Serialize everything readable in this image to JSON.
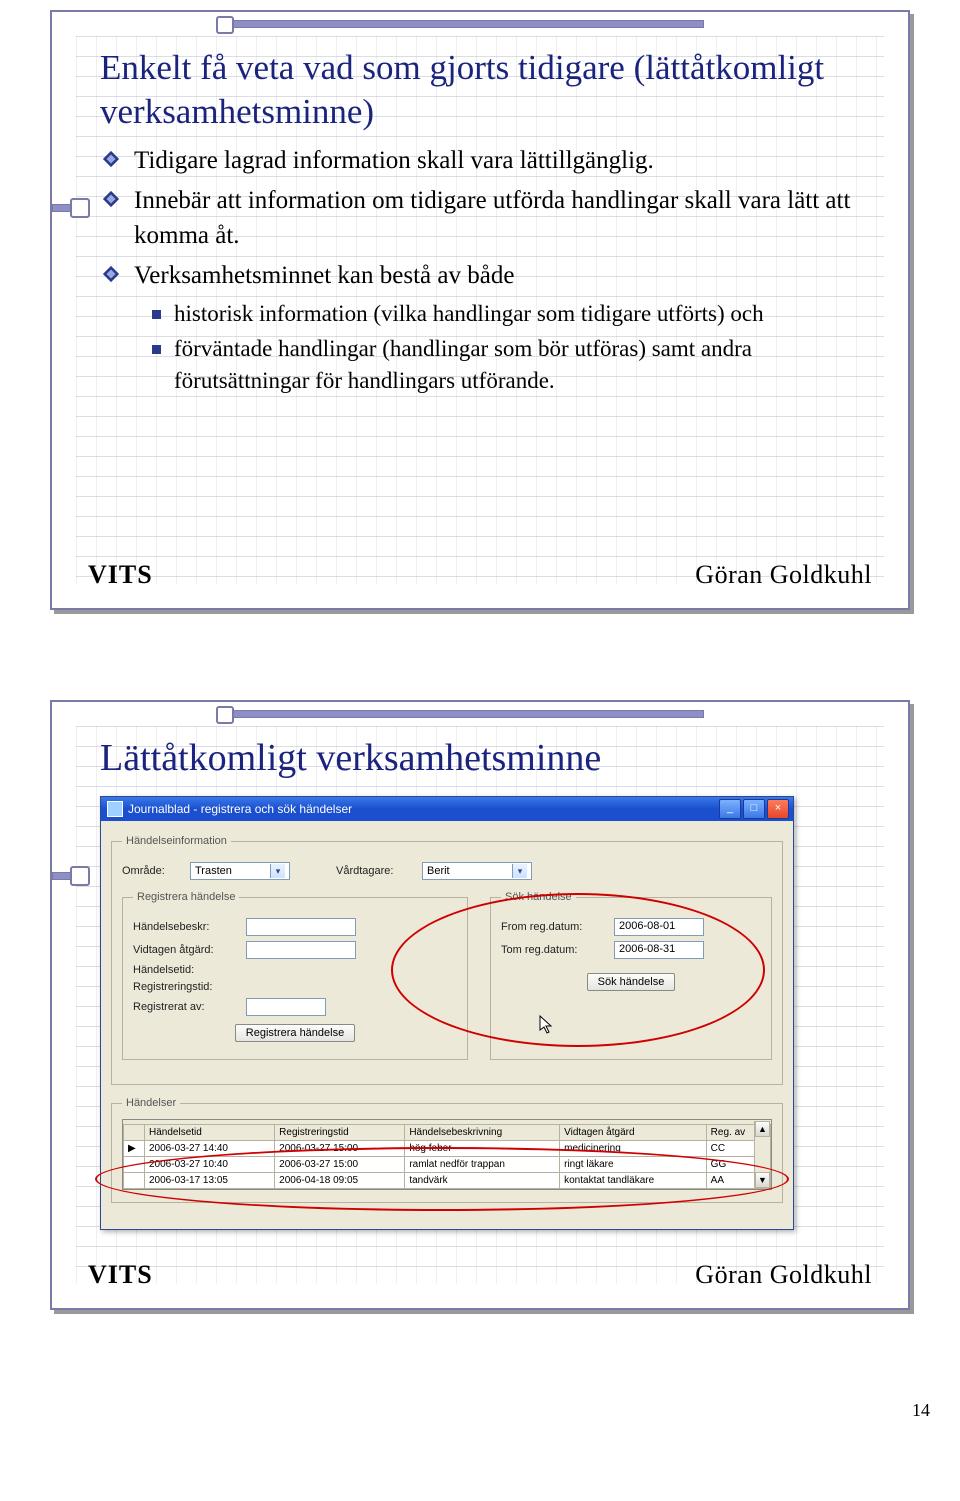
{
  "page_number": "14",
  "slide1": {
    "title": "Enkelt få veta vad som gjorts tidigare (lättåtkomligt verksamhetsminne)",
    "bullets": [
      "Tidigare lagrad information skall vara lättillgänglig.",
      "Innebär att information om tidigare utförda handlingar skall vara lätt att komma åt.",
      "Verksamhetsminnet kan bestå av både"
    ],
    "sub_bullets": [
      "historisk information (vilka handlingar som tidigare utförts) och",
      "förväntade handlingar (handlingar som bör utföras) samt andra förutsättningar för handlingars utförande."
    ],
    "footer_left": "VITS",
    "footer_right": "Göran Goldkuhl"
  },
  "slide2": {
    "title": "Lättåtkomligt verksamhetsminne",
    "footer_left": "VITS",
    "footer_right": "Göran Goldkuhl",
    "app": {
      "window_title": "Journalblad - registrera och sök händelser",
      "win_min": "_",
      "win_max": "□",
      "win_close": "×",
      "info_legend": "Händelseinformation",
      "omrade_label": "Område:",
      "omrade_value": "Trasten",
      "vardtagare_label": "Vårdtagare:",
      "vardtagare_value": "Berit",
      "reg_legend": "Registrera händelse",
      "fields": {
        "handelsebeskr": "Händelsebeskr:",
        "vidtagen": "Vidtagen åtgärd:",
        "handelsetid": "Händelsetid:",
        "registreringstid": "Registreringstid:",
        "registrerat_av": "Registrerat av:"
      },
      "reg_button": "Registrera händelse",
      "sok_legend": "Sök händelse",
      "from_label": "From reg.datum:",
      "from_value": "2006-08-01",
      "tom_label": "Tom reg.datum:",
      "tom_value": "2006-08-31",
      "sok_button": "Sök händelse",
      "hand_legend": "Händelser",
      "table": {
        "headers": [
          "",
          "Händelsetid",
          "Registreringstid",
          "Händelsebeskrivning",
          "Vidtagen åtgärd",
          "Reg. av"
        ],
        "rows": [
          [
            "▶",
            "2006-03-27 14:40",
            "2006-03-27 15:00",
            "hög feber",
            "medicinering",
            "CC"
          ],
          [
            "",
            "2006-03-27 10:40",
            "2006-03-27 15:00",
            "ramlat nedför trappan",
            "ringt läkare",
            "GG"
          ],
          [
            "",
            "2006-03-17 13:05",
            "2006-04-18 09:05",
            "tandvärk",
            "kontaktat tandläkare",
            "AA"
          ]
        ],
        "scroll_up": "▲",
        "scroll_down": "▼"
      }
    }
  },
  "chart_data": {
    "type": "table",
    "title": "Händelser",
    "headers": [
      "Händelsetid",
      "Registreringstid",
      "Händelsebeskrivning",
      "Vidtagen åtgärd",
      "Reg. av"
    ],
    "rows": [
      [
        "2006-03-27 14:40",
        "2006-03-27 15:00",
        "hög feber",
        "medicinering",
        "CC"
      ],
      [
        "2006-03-27 10:40",
        "2006-03-27 15:00",
        "ramlat nedför trappan",
        "ringt läkare",
        "GG"
      ],
      [
        "2006-03-17 13:05",
        "2006-04-18 09:05",
        "tandvärk",
        "kontaktat tandläkare",
        "AA"
      ]
    ]
  }
}
